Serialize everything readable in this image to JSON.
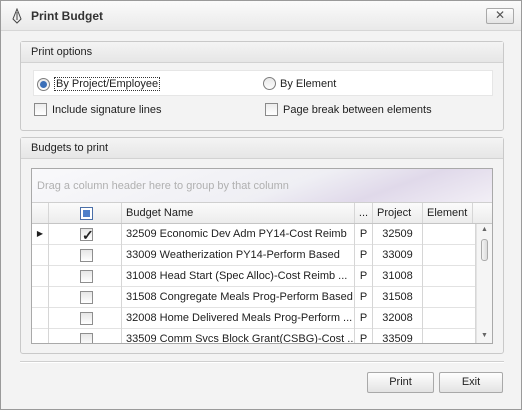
{
  "window": {
    "title": "Print Budget",
    "close_glyph": "✕"
  },
  "print_options": {
    "header": "Print options",
    "radio_by_project": "By Project/Employee",
    "radio_by_element": "By Element",
    "selected_radio": "By Project/Employee",
    "include_signature": "Include signature lines",
    "page_break": "Page break between elements"
  },
  "budgets": {
    "header": "Budgets to print",
    "group_panel_hint": "Drag a column header here to group by that column",
    "columns": {
      "name": "Budget Name",
      "type": "...",
      "project": "Project",
      "element": "Element"
    },
    "rows": [
      {
        "checked": true,
        "current": true,
        "name": "32509 Economic Dev Adm PY14-Cost Reimb",
        "type": "P",
        "project": "32509",
        "element": ""
      },
      {
        "checked": false,
        "current": false,
        "name": "33009 Weatherization  PY14-Perform Based",
        "type": "P",
        "project": "33009",
        "element": ""
      },
      {
        "checked": false,
        "current": false,
        "name": "31008 Head Start (Spec Alloc)-Cost Reimb  ...",
        "type": "P",
        "project": "31008",
        "element": ""
      },
      {
        "checked": false,
        "current": false,
        "name": "31508 Congregate Meals Prog-Perform Based",
        "type": "P",
        "project": "31508",
        "element": ""
      },
      {
        "checked": false,
        "current": false,
        "name": "32008 Home Delivered Meals Prog-Perform ...",
        "type": "P",
        "project": "32008",
        "element": ""
      },
      {
        "checked": false,
        "current": false,
        "name": "33509 Comm Svcs Block Grant(CSBG)-Cost ...",
        "type": "P",
        "project": "33509",
        "element": ""
      }
    ]
  },
  "buttons": {
    "print": "Print",
    "exit": "Exit"
  },
  "colors": {
    "accent": "#3b6fb8",
    "grid_border": "#a9a9a9"
  },
  "icons": {
    "app": "pen-nib-icon",
    "current_row": "row-indicator-icon"
  }
}
